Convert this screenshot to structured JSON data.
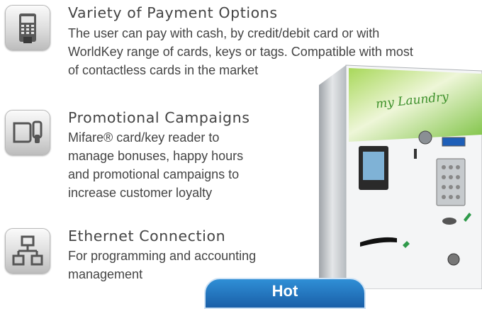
{
  "features": [
    {
      "title": "Variety of Payment Options",
      "lines": [
        "The user can pay with cash, by credit/debit card or with",
        "WorldKey range of cards, keys or tags. Compatible with most",
        "of contactless cards  in the market"
      ],
      "icon": "payment-terminal-icon"
    },
    {
      "title": "Promotional Campaigns",
      "lines": [
        "Mifare® card/key reader to",
        "manage bonuses, happy hours",
        "and promotional campaigns to",
        "increase customer loyalty"
      ],
      "icon": "card-and-key-icon"
    },
    {
      "title": "Ethernet Connection",
      "lines": [
        "For programming and accounting",
        "management"
      ],
      "icon": "network-icon"
    }
  ],
  "machine": {
    "brand": "my Laundry",
    "colors": {
      "panel_green": "#7cc242",
      "steel": "#c9cdd2"
    }
  },
  "badge": {
    "label": "Hot"
  }
}
